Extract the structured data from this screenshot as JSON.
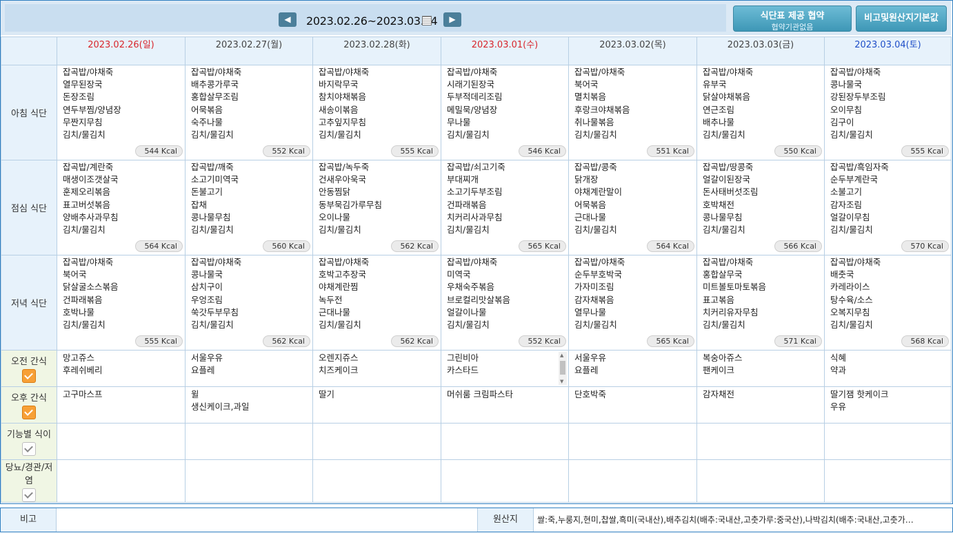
{
  "nav": {
    "range": "2023.02.26~2023.03.04",
    "prev_icon": "chevron-left-icon",
    "next_icon": "chevron-right-icon"
  },
  "buttons": {
    "agreement": "식단표 제공 협약",
    "agreement_sub": "협약기관없음",
    "remarks": "비고및원산지기본값"
  },
  "days": [
    {
      "label": "2023.02.26(일)",
      "color": "red"
    },
    {
      "label": "2023.02.27(월)",
      "color": "normal"
    },
    {
      "label": "2023.02.28(화)",
      "color": "normal"
    },
    {
      "label": "2023.03.01(수)",
      "color": "red"
    },
    {
      "label": "2023.03.02(목)",
      "color": "normal"
    },
    {
      "label": "2023.03.03(금)",
      "color": "normal"
    },
    {
      "label": "2023.03.04(토)",
      "color": "blue"
    }
  ],
  "rows": [
    {
      "label": "아침 식단",
      "type": "meal",
      "cells": [
        {
          "items": [
            "잡곡밥/야채죽",
            "열무된장국",
            "돈장조림",
            "연두부찜/양념장",
            "무짠지무침",
            "김치/물김치"
          ],
          "kcal": "544 Kcal"
        },
        {
          "items": [
            "잡곡밥/야채죽",
            "배추콩가루국",
            "홍합살무조림",
            "어묵볶음",
            "숙주나물",
            "김치/물김치"
          ],
          "kcal": "552 Kcal"
        },
        {
          "items": [
            "잡곡밥/야채죽",
            "바지락무국",
            "참치야채볶음",
            "새송이볶음",
            "고추잎지무침",
            "김치/물김치"
          ],
          "kcal": "555 Kcal"
        },
        {
          "items": [
            "잡곡밥/야채죽",
            "시래기된장국",
            "두부적데리조림",
            "메밀묵/양념장",
            "무나물",
            "김치/물김치"
          ],
          "kcal": "546 Kcal"
        },
        {
          "items": [
            "잡곡밥/야채죽",
            "북어국",
            "멸치볶음",
            "후랑크야채볶음",
            "취나물볶음",
            "김치/물김치"
          ],
          "kcal": "551 Kcal"
        },
        {
          "items": [
            "잡곡밥/야채죽",
            "유부국",
            "닭살야채볶음",
            "연근조림",
            "배추나물",
            "김치/물김치"
          ],
          "kcal": "550 Kcal"
        },
        {
          "items": [
            "잡곡밥/야채죽",
            "콩나물국",
            "강된장두부조림",
            "오이무침",
            "김구이",
            "김치/물김치"
          ],
          "kcal": "555 Kcal"
        }
      ]
    },
    {
      "label": "점심 식단",
      "type": "meal",
      "cells": [
        {
          "items": [
            "잡곡밥/계란죽",
            "매생이조갯살국",
            "훈제오리볶음",
            "표고버섯볶음",
            "양배추사과무침",
            "김치/물김치"
          ],
          "kcal": "564 Kcal"
        },
        {
          "items": [
            "잡곡밥/깨죽",
            "소고기미역국",
            "돈불고기",
            "잡채",
            "콩나물무침",
            "김치/물김치"
          ],
          "kcal": "560 Kcal"
        },
        {
          "items": [
            "잡곡밥/녹두죽",
            "건새우아욱국",
            "안동찜닭",
            "동부묵김가루무침",
            "오이나물",
            "김치/물김치"
          ],
          "kcal": "562 Kcal"
        },
        {
          "items": [
            "잡곡밥/쇠고기죽",
            "부대찌개",
            "소고기두부조림",
            "건파래볶음",
            "치커리사과무침",
            "김치/물김치"
          ],
          "kcal": "565 Kcal"
        },
        {
          "items": [
            "잡곡밥/콩죽",
            "닭개장",
            "야채계란말이",
            "어묵볶음",
            "근대나물",
            "김치/물김치"
          ],
          "kcal": "564 Kcal"
        },
        {
          "items": [
            "잡곡밥/땅콩죽",
            "얼갈이된장국",
            "돈사태버섯조림",
            "호박채전",
            "콩나물무침",
            "김치/물김치"
          ],
          "kcal": "566 Kcal"
        },
        {
          "items": [
            "잡곡밥/흑임자죽",
            "순두부계란국",
            "소불고기",
            "감자조림",
            "얼갈이무침",
            "김치/물김치"
          ],
          "kcal": "570 Kcal"
        }
      ]
    },
    {
      "label": "저녁 식단",
      "type": "meal",
      "cells": [
        {
          "items": [
            "잡곡밥/야채죽",
            "북어국",
            "닭살굴소스볶음",
            "건파래볶음",
            "호박나물",
            "김치/물김치"
          ],
          "kcal": "555 Kcal"
        },
        {
          "items": [
            "잡곡밥/야채죽",
            "콩나물국",
            "삼치구이",
            "우엉조림",
            "쑥갓두부무침",
            "김치/물김치"
          ],
          "kcal": "562 Kcal"
        },
        {
          "items": [
            "잡곡밥/야채죽",
            "호박고추장국",
            "야채계란찜",
            "녹두전",
            "근대나물",
            "김치/물김치"
          ],
          "kcal": "562 Kcal"
        },
        {
          "items": [
            "잡곡밥/야채죽",
            "미역국",
            "우채숙주볶음",
            "브로컬리맛살볶음",
            "얼갈이나물",
            "김치/물김치"
          ],
          "kcal": "552 Kcal"
        },
        {
          "items": [
            "잡곡밥/야채죽",
            "순두부호박국",
            "가자미조림",
            "감자채볶음",
            "열무나물",
            "김치/물김치"
          ],
          "kcal": "565 Kcal"
        },
        {
          "items": [
            "잡곡밥/야채죽",
            "홍합살무국",
            "미트볼토마토볶음",
            "표고볶음",
            "치커리유자무침",
            "김치/물김치"
          ],
          "kcal": "571 Kcal"
        },
        {
          "items": [
            "잡곡밥/야채죽",
            "배춧국",
            "카레라이스",
            "탕수육/소스",
            "오복지무침",
            "김치/물김치"
          ],
          "kcal": "568 Kcal"
        }
      ]
    },
    {
      "label": "오전 간식",
      "type": "snack",
      "checked": true,
      "cells": [
        {
          "items": [
            "망고쥬스",
            "후레쉬베리"
          ]
        },
        {
          "items": [
            "서울우유",
            "요플레"
          ]
        },
        {
          "items": [
            "오렌지쥬스",
            "치즈케이크"
          ]
        },
        {
          "items": [
            "그린비아",
            "카스타드"
          ],
          "scroll": true
        },
        {
          "items": [
            "서울우유",
            "요플레"
          ]
        },
        {
          "items": [
            "복숭아쥬스",
            "팬케이크"
          ]
        },
        {
          "items": [
            "식혜",
            "약과"
          ]
        }
      ]
    },
    {
      "label": "오후 간식",
      "type": "snack",
      "checked": true,
      "cells": [
        {
          "items": [
            "고구마스프"
          ]
        },
        {
          "items": [
            "윌",
            "생신케이크,과일"
          ]
        },
        {
          "items": [
            "딸기"
          ]
        },
        {
          "items": [
            "머쉬룸 크림파스타"
          ]
        },
        {
          "items": [
            "단호박죽"
          ]
        },
        {
          "items": [
            "감자채전"
          ]
        },
        {
          "items": [
            "딸기잼 핫케이크",
            "우유"
          ]
        }
      ]
    },
    {
      "label": "기능별 식이",
      "type": "empty",
      "checked": false,
      "cells": []
    },
    {
      "label": "당뇨/경관/저염",
      "type": "empty",
      "checked": false,
      "cells": []
    }
  ],
  "footer": {
    "remarks_label": "비고",
    "remarks_value": "",
    "origin_label": "원산지",
    "origin_value": "쌀:죽,누룽지,현미,찹쌀,흑미(국내산),배추김치(배추:국내산,고춧가루:중국산),나박김치(배추:국내산,고춧가…"
  }
}
